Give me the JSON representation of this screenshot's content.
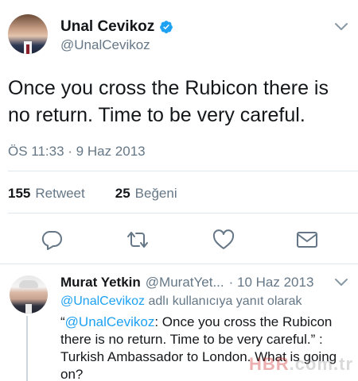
{
  "main_tweet": {
    "display_name": "Unal Cevikoz",
    "handle": "@UnalCevikoz",
    "text": "Once you cross the Rubicon there is no return. Time to be very careful.",
    "timestamp": "ÖS 11:33 · 9 Haz 2013",
    "retweets": {
      "count": "155",
      "label": "Retweet"
    },
    "likes": {
      "count": "25",
      "label": "Beğeni"
    },
    "actions": [
      "reply-icon",
      "retweet-icon",
      "like-icon",
      "direct-message-icon"
    ]
  },
  "reply": {
    "display_name": "Murat Yetkin",
    "handle": "@MuratYet...",
    "date": "· 10 Haz 2013",
    "replying_to_mention": "@UnalCevikoz",
    "replying_to_suffix": " adlı kullanıcıya yanıt olarak",
    "text_prefix": "“",
    "text_mention": "@UnalCevikoz",
    "text_body": ": Once you cross the Rubicon there is no return. Time to be very careful.” : Turkish Ambassador to London. What is going on?"
  },
  "watermark": {
    "brand": "HBR",
    "suffix": ".com.tr"
  },
  "colors": {
    "accent": "#1da1f2",
    "muted": "#657786",
    "text": "#14171a",
    "divider": "#e1e8ed"
  }
}
